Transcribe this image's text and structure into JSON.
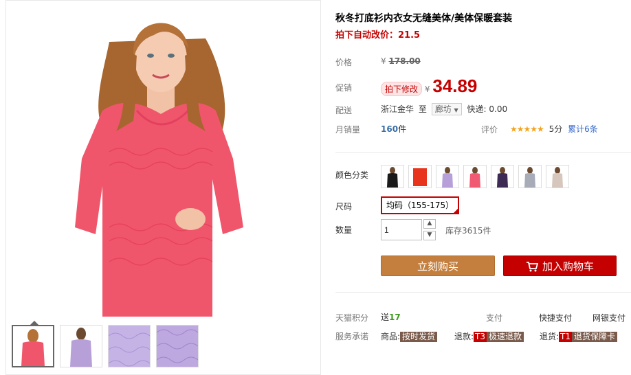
{
  "product": {
    "title": "秋冬打底衫内衣女无缝美体/美体保暖套装",
    "subtitle": "拍下自动改价：21.5"
  },
  "price": {
    "label": "价格",
    "currency": "¥",
    "original": "178.00",
    "promo_label": "促销",
    "promo_badge": "拍下修改",
    "promo_price": "34.89"
  },
  "shipping": {
    "label": "配送",
    "from": "浙江金华",
    "to_word": "至",
    "destination": "廊坊",
    "fee": "快递: 0.00"
  },
  "sales": {
    "label": "月销量",
    "count": "160",
    "unit": "件",
    "rating_label": "评价",
    "stars": "★★★★★",
    "score": "5分",
    "reviews": "累计6条"
  },
  "color": {
    "label": "颜色分类",
    "swatches": [
      "black",
      "red",
      "lavender",
      "pink",
      "purple",
      "grey",
      "beige"
    ],
    "swatch_colors": [
      "#1a1a1a",
      "#e8341c",
      "#b7a0d8",
      "#f05a72",
      "#3d2a55",
      "#a8abb8",
      "#d7c6bc"
    ]
  },
  "size": {
    "label": "尺码",
    "value": "均码（155-175）"
  },
  "quantity": {
    "label": "数量",
    "value": "1",
    "stock": "库存3615件"
  },
  "buttons": {
    "buy": "立刻购买",
    "cart": "加入购物车"
  },
  "extras": {
    "points_label": "天猫积分",
    "points_prefix": "送",
    "points_value": "17",
    "pay_label": "支付",
    "pay_quick": "快捷支付",
    "pay_bank": "网银支付",
    "service_label": "服务承诺",
    "svc_goods_label": "商品:",
    "svc_goods_tag": "按时发货",
    "svc_refund_label": "退款:",
    "svc_refund_code": "T3",
    "svc_refund_tag": "极速退款",
    "svc_return_label": "退货:",
    "svc_return_code": "T1",
    "svc_return_tag": "退货保障卡"
  },
  "colors": {
    "accent": "#c40000",
    "buy_button": "#c47f3e",
    "garment": "#f0566b"
  }
}
